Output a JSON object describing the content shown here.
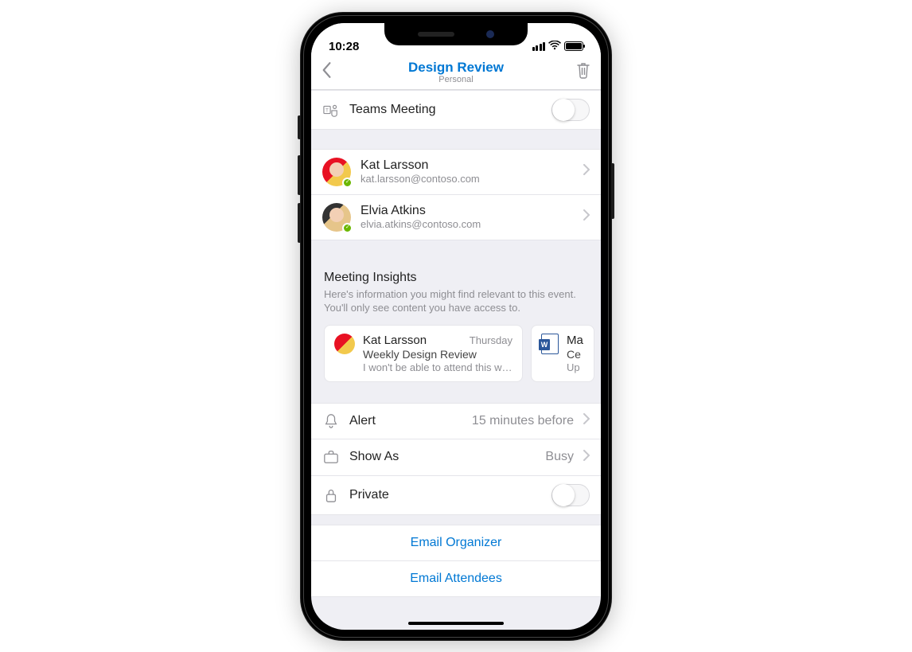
{
  "status": {
    "time": "10:28"
  },
  "nav": {
    "title": "Design Review",
    "subtitle": "Personal"
  },
  "teams": {
    "label": "Teams Meeting"
  },
  "people": [
    {
      "name": "Kat Larsson",
      "email": "kat.larsson@contoso.com"
    },
    {
      "name": "Elvia Atkins",
      "email": "elvia.atkins@contoso.com"
    }
  ],
  "insights": {
    "title": "Meeting Insights",
    "description": "Here's information you might find relevant to this event. You'll only see content you have access to."
  },
  "cards": {
    "email": {
      "from": "Kat Larsson",
      "date": "Thursday",
      "subject": "Weekly Design Review",
      "preview": "I won't be able to attend this w…"
    },
    "doc": {
      "title": "Ma",
      "line2": "Ce",
      "line3": "Up"
    }
  },
  "settings": {
    "alert": {
      "label": "Alert",
      "value": "15 minutes before"
    },
    "showAs": {
      "label": "Show As",
      "value": "Busy"
    },
    "private": {
      "label": "Private"
    }
  },
  "actions": {
    "emailOrganizer": "Email Organizer",
    "emailAttendees": "Email Attendees"
  }
}
